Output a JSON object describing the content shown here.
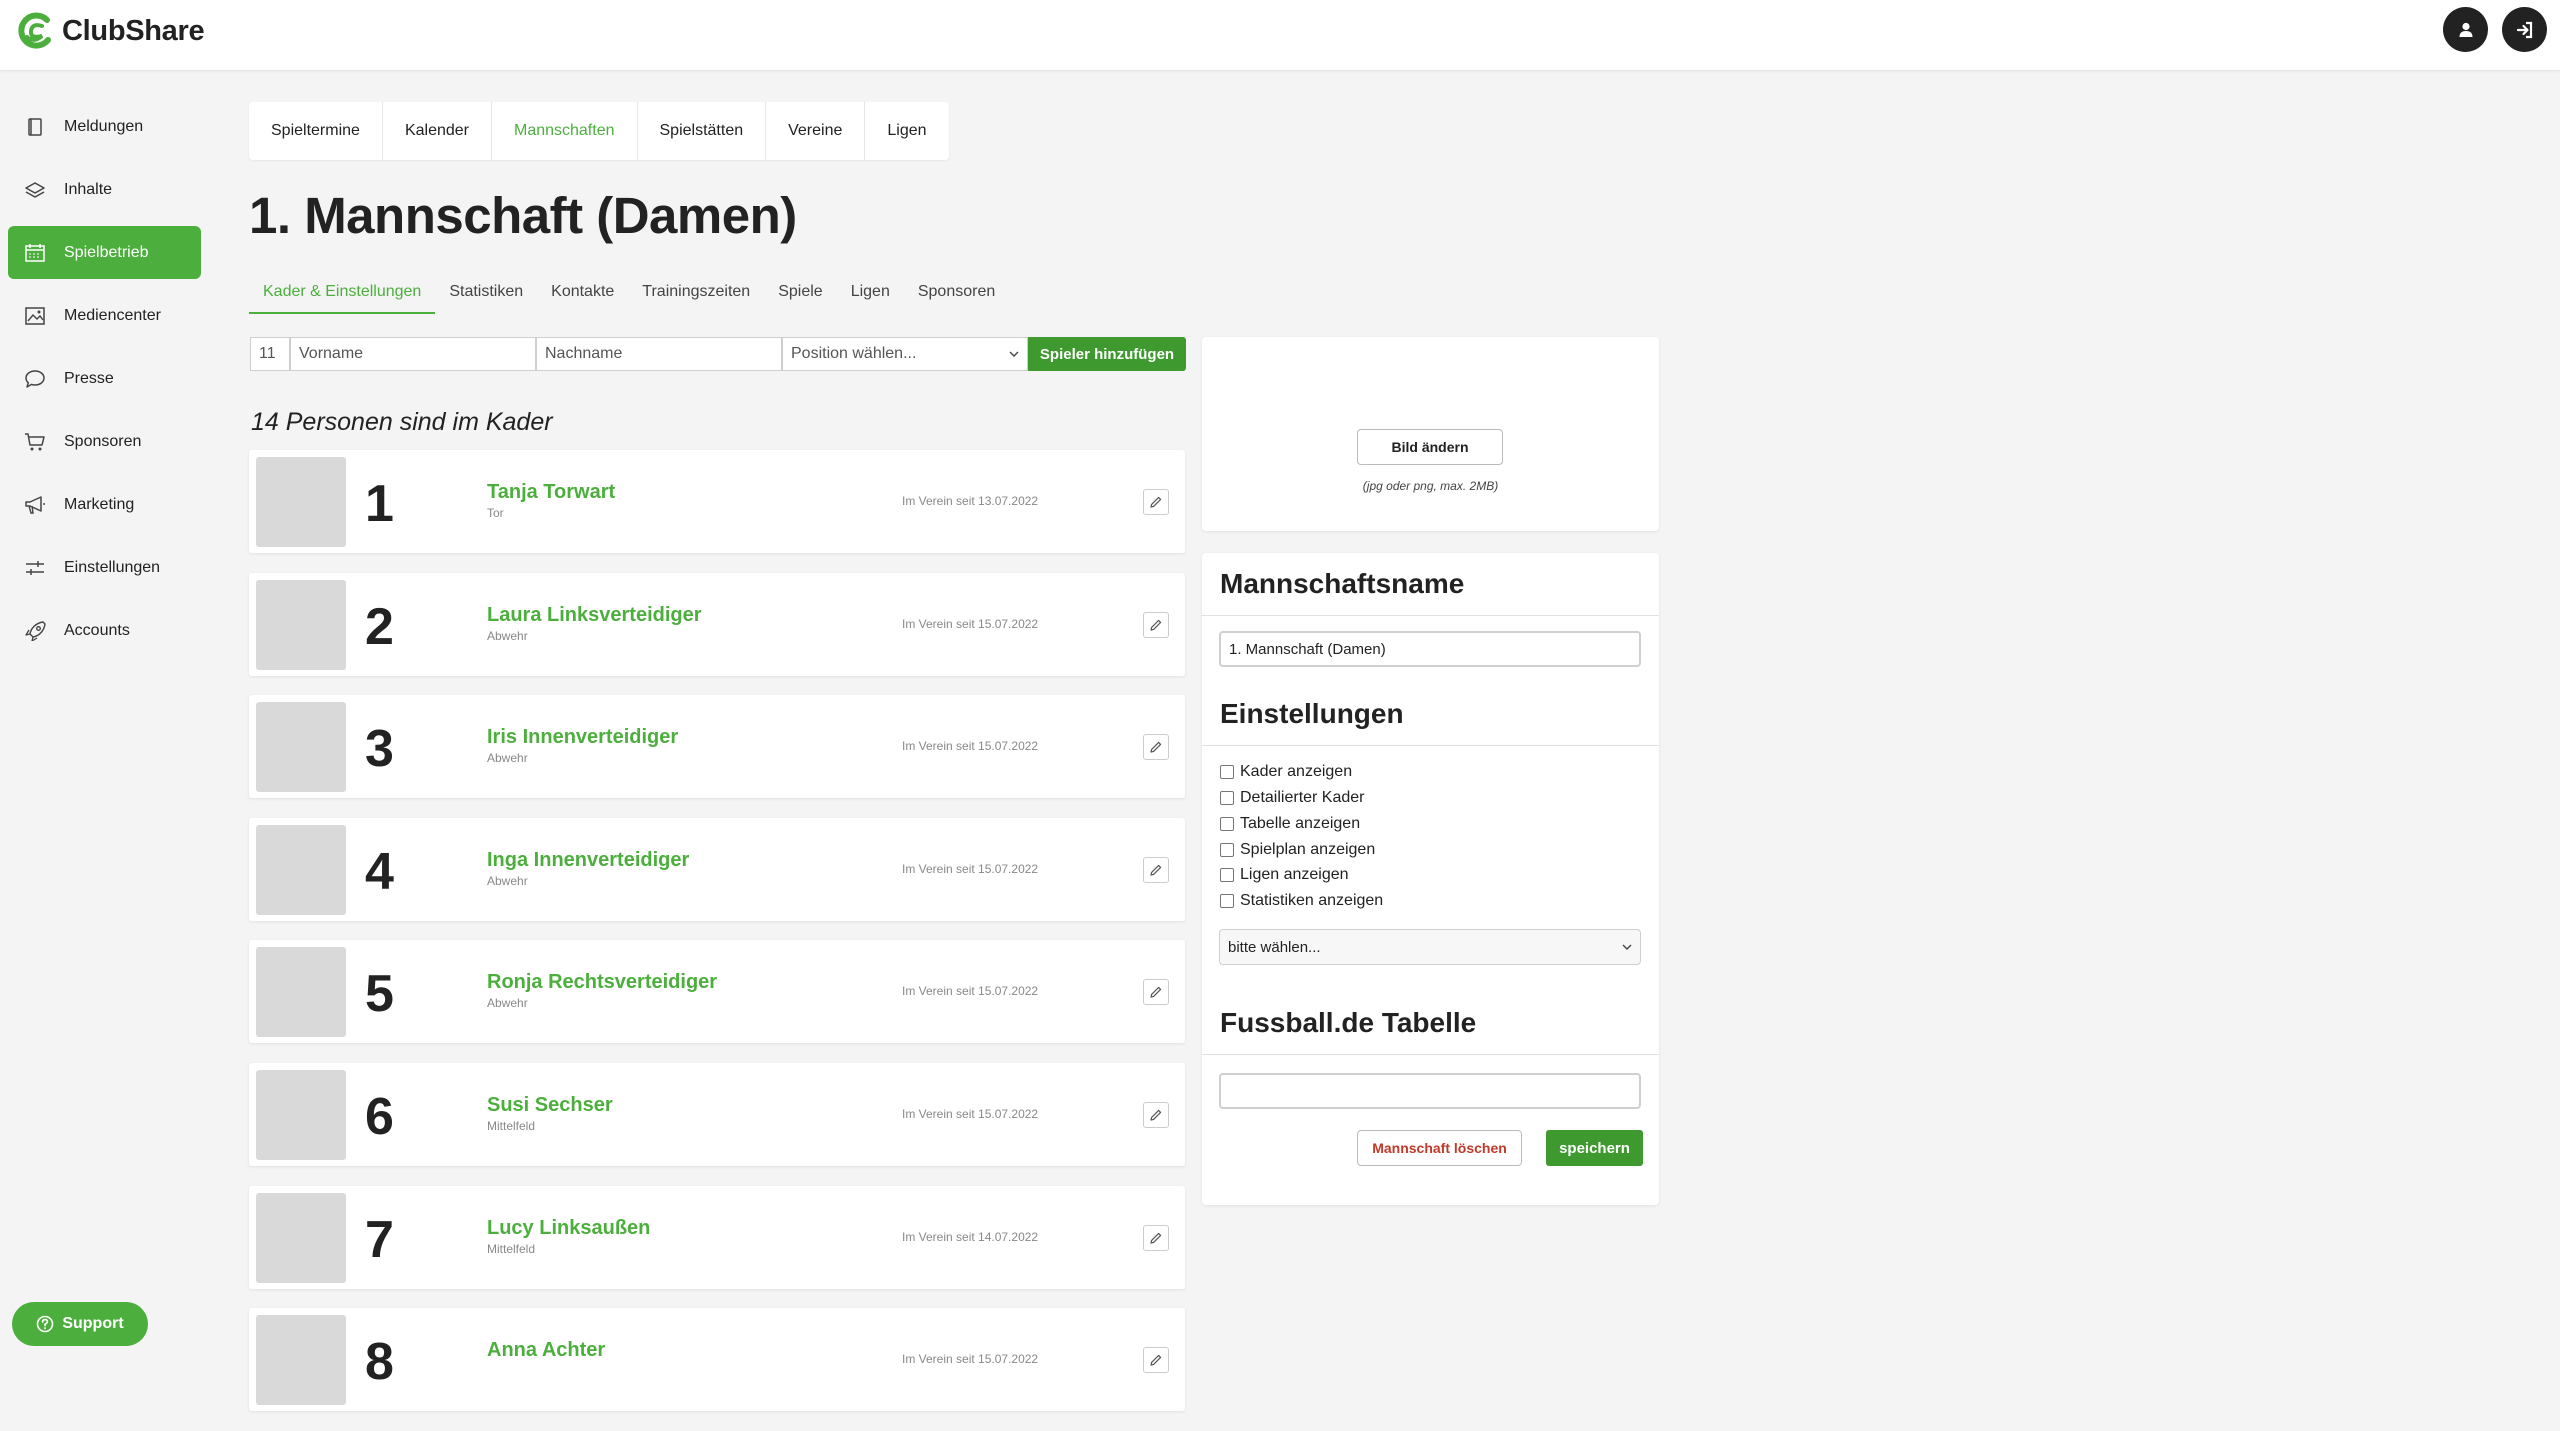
{
  "app": {
    "name": "ClubShare",
    "brand_color": "#4caf3d",
    "header_icons": [
      "user-icon",
      "logout-icon"
    ]
  },
  "sidebar": {
    "items": [
      {
        "label": "Meldungen",
        "icon": "book-icon"
      },
      {
        "label": "Inhalte",
        "icon": "layers-icon"
      },
      {
        "label": "Spielbetrieb",
        "icon": "calendar-icon",
        "active": true
      },
      {
        "label": "Mediencenter",
        "icon": "image-icon"
      },
      {
        "label": "Presse",
        "icon": "speech-bubble-icon"
      },
      {
        "label": "Sponsoren",
        "icon": "cart-icon"
      },
      {
        "label": "Marketing",
        "icon": "megaphone-icon"
      },
      {
        "label": "Einstellungen",
        "icon": "sliders-icon"
      },
      {
        "label": "Accounts",
        "icon": "rocket-icon"
      }
    ],
    "support_label": "Support"
  },
  "top_tabs": [
    "Spieltermine",
    "Kalender",
    "Mannschaften",
    "Spielstätten",
    "Vereine",
    "Ligen"
  ],
  "top_tabs_active": "Mannschaften",
  "page_title": "1. Mannschaft (Damen)",
  "sub_tabs": [
    "Kader & Einstellungen",
    "Statistiken",
    "Kontakte",
    "Trainingszeiten",
    "Spiele",
    "Ligen",
    "Sponsoren"
  ],
  "sub_tabs_active": "Kader & Einstellungen",
  "add_player": {
    "number_value": "11",
    "firstname_placeholder": "Vorname",
    "lastname_placeholder": "Nachname",
    "position_placeholder": "Position wählen...",
    "add_button": "Spieler hinzufügen"
  },
  "kader": {
    "heading": "14 Personen sind im Kader",
    "players": [
      {
        "number": "1",
        "name": "Tanja Torwart",
        "position": "Tor",
        "since": "Im Verein seit 13.07.2022"
      },
      {
        "number": "2",
        "name": "Laura Linksverteidiger",
        "position": "Abwehr",
        "since": "Im Verein seit 15.07.2022"
      },
      {
        "number": "3",
        "name": "Iris Innenverteidiger",
        "position": "Abwehr",
        "since": "Im Verein seit 15.07.2022"
      },
      {
        "number": "4",
        "name": "Inga Innenverteidiger",
        "position": "Abwehr",
        "since": "Im Verein seit 15.07.2022"
      },
      {
        "number": "5",
        "name": "Ronja Rechtsverteidiger",
        "position": "Abwehr",
        "since": "Im Verein seit 15.07.2022"
      },
      {
        "number": "6",
        "name": "Susi Sechser",
        "position": "Mittelfeld",
        "since": "Im Verein seit 15.07.2022"
      },
      {
        "number": "7",
        "name": "Lucy Linksaußen",
        "position": "Mittelfeld",
        "since": "Im Verein seit 14.07.2022"
      },
      {
        "number": "8",
        "name": "Anna Achter",
        "position": "",
        "since": "Im Verein seit 15.07.2022"
      }
    ]
  },
  "image_panel": {
    "change_button": "Bild ändern",
    "hint": "(jpg oder png, max. 2MB)"
  },
  "settings": {
    "team_name_heading": "Mannschaftsname",
    "team_name_value": "1. Mannschaft (Damen)",
    "settings_heading": "Einstellungen",
    "checkboxes": [
      {
        "label": "Kader anzeigen",
        "checked": false
      },
      {
        "label": "Detailierter Kader",
        "checked": false
      },
      {
        "label": "Tabelle anzeigen",
        "checked": false
      },
      {
        "label": "Spielplan anzeigen",
        "checked": false
      },
      {
        "label": "Ligen anzeigen",
        "checked": false
      },
      {
        "label": "Statistiken anzeigen",
        "checked": false
      }
    ],
    "select_value": "bitte wählen...",
    "fussball_heading": "Fussball.de Tabelle",
    "fussball_value": "",
    "delete_button": "Mannschaft löschen",
    "save_button": "speichern"
  }
}
